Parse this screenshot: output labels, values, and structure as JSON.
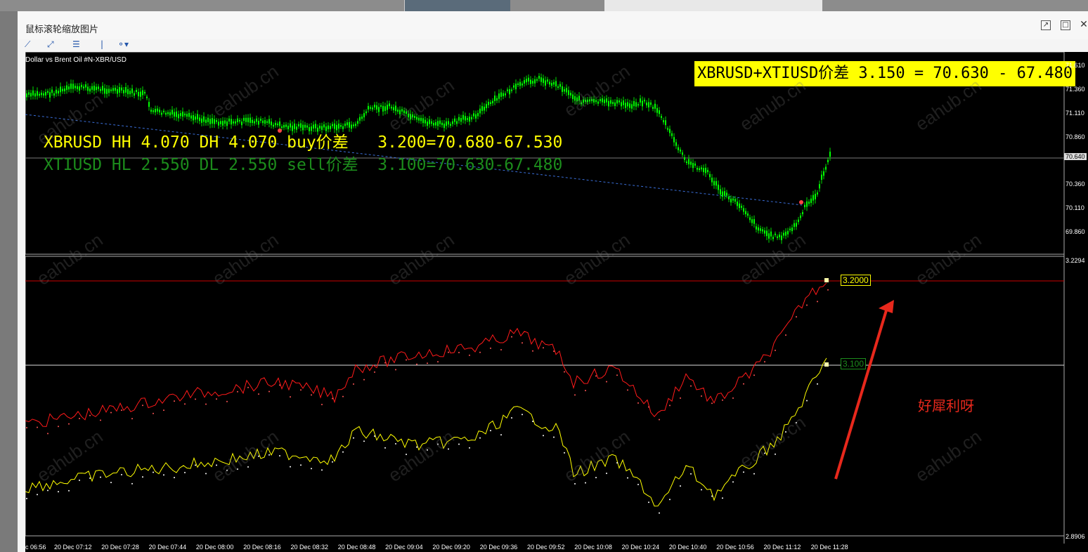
{
  "window": {
    "title": "鼠标滚轮缩放图片",
    "buttons": [
      "external-link-icon",
      "restore-icon",
      "close-icon"
    ]
  },
  "toolbar": {
    "tools": [
      "line-tool-icon",
      "trend-tool-icon",
      "channel-tool-icon",
      "vertical-line-icon",
      "shapes-dropdown-icon"
    ]
  },
  "chart": {
    "symbol_label": "Dollar vs Brent Oil #N-XBR/USD",
    "info_line1": "XBRUSD HH 4.070 DH 4.070 buy价差   3.200=70.680-67.530",
    "info_line2": "XTIUSD HL 2.550 DL 2.550 sell价差  3.100=70.630-67.480",
    "spread_box": "XBRUSD+XTIUSD价差 3.150 = 70.630 - 67.480",
    "current_price": "70.640",
    "price_labels": [
      "71.610",
      "71.360",
      "71.110",
      "70.860",
      "70.610",
      "70.360",
      "70.110",
      "69.860"
    ],
    "sub_price_labels": [
      "3.2294",
      "2.8906"
    ],
    "level_red": "3.2000",
    "level_white": "3.100",
    "time_labels": [
      "c 06:56",
      "20 Dec 07:12",
      "20 Dec 07:28",
      "20 Dec 07:44",
      "20 Dec 08:00",
      "20 Dec 08:16",
      "20 Dec 08:32",
      "20 Dec 08:48",
      "20 Dec 09:04",
      "20 Dec 09:20",
      "20 Dec 09:36",
      "20 Dec 09:52",
      "20 Dec 10:08",
      "20 Dec 10:24",
      "20 Dec 10:40",
      "20 Dec 10:56",
      "20 Dec 11:12",
      "20 Dec 11:28"
    ],
    "annotation": "好犀利呀",
    "watermark": "eahub.cn"
  },
  "colors": {
    "candles": "#00ff00",
    "info1": "#ffff00",
    "info2": "#1c8c1c",
    "red_series": "#ff0000",
    "yellow_series": "#ffff00",
    "annotation": "#e8281c"
  },
  "chart_data": {
    "type": "line",
    "title": "Dollar vs Brent Oil #N-XBR/USD",
    "price_ylim": [
      69.86,
      71.61
    ],
    "indicator_ylim": [
      2.8906,
      3.2294
    ],
    "series": [
      {
        "name": "XBRUSD buy价差",
        "last": 3.2
      },
      {
        "name": "XTIUSD sell价差",
        "last": 3.1
      }
    ]
  }
}
